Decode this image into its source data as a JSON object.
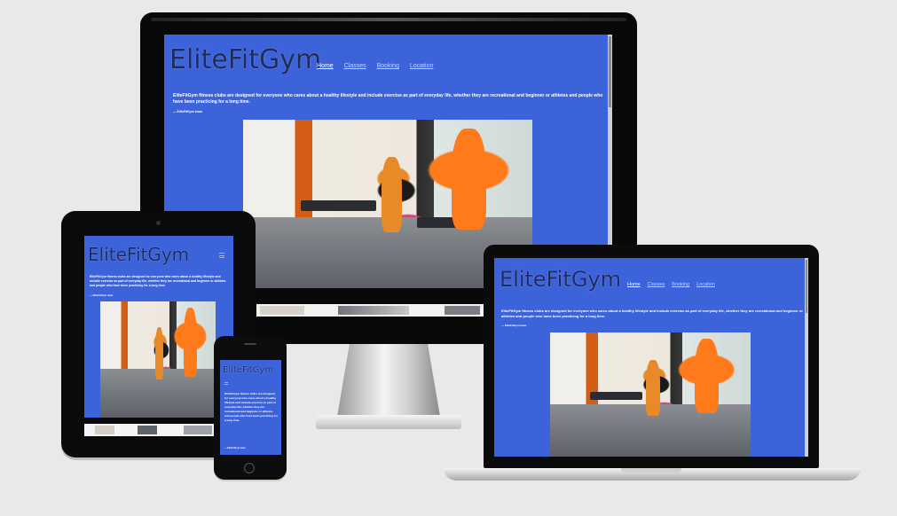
{
  "site": {
    "logo": "EliteFitGym",
    "nav": [
      "Home",
      "Classes",
      "Booking",
      "Location"
    ],
    "intro": "EliteFitGym fitness clubs are designed for everyone who cares about a healthy lifestyle and include exercise as part of everyday life, whether they are recreational and beginner or athletes and people who have been practicing for a long time.",
    "signature": "— EliteFitGym team"
  },
  "icons": {
    "hamburger": "hamburger-menu-icon"
  },
  "colors": {
    "brand_blue": "#3d63db",
    "logo_text": "#1e2b5c",
    "background": "#e9e9e9"
  }
}
